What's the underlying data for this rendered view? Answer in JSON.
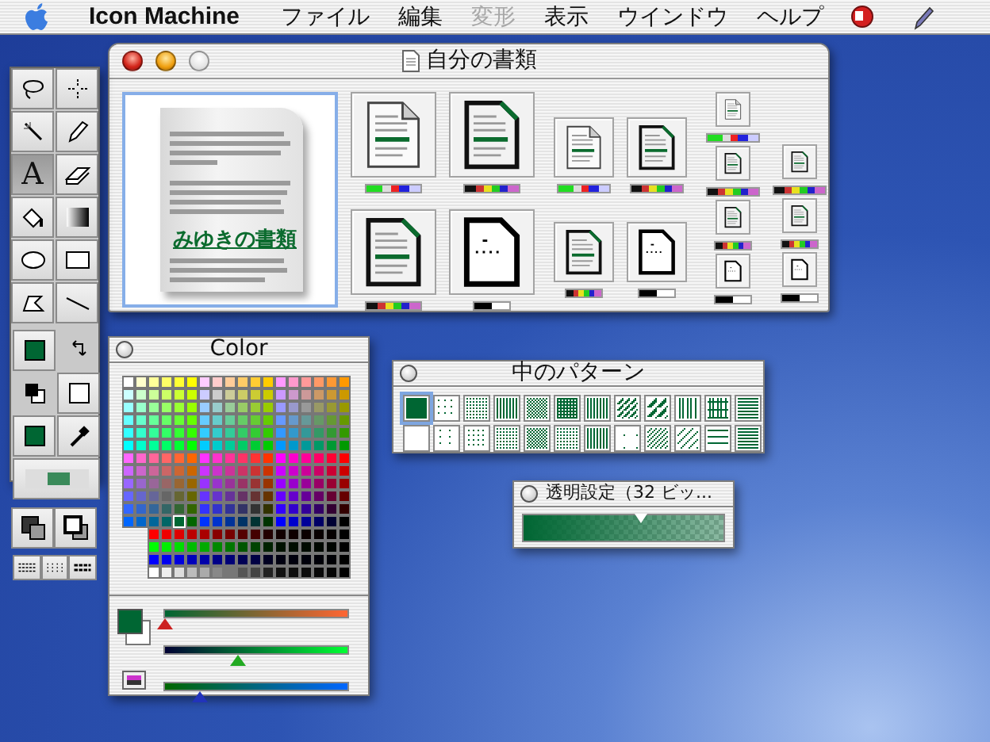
{
  "menu_bar": {
    "items": [
      {
        "label": "Icon Machine",
        "kind": "app",
        "disabled": false
      },
      {
        "label": "ファイル",
        "kind": "menu",
        "disabled": false
      },
      {
        "label": "編集",
        "kind": "menu",
        "disabled": false
      },
      {
        "label": "変形",
        "kind": "menu",
        "disabled": true
      },
      {
        "label": "表示",
        "kind": "menu",
        "disabled": false
      },
      {
        "label": "ウインドウ",
        "kind": "menu",
        "disabled": false
      },
      {
        "label": "ヘルプ",
        "kind": "menu",
        "disabled": false
      }
    ]
  },
  "tools": [
    {
      "kind": "lasso",
      "selected": false
    },
    {
      "kind": "marquee",
      "selected": false
    },
    {
      "kind": "wand",
      "selected": false
    },
    {
      "kind": "pencil",
      "selected": false
    },
    {
      "kind": "text",
      "label": "A",
      "selected": true
    },
    {
      "kind": "eraser",
      "selected": false
    },
    {
      "kind": "bucket",
      "selected": false
    },
    {
      "kind": "gradient",
      "selected": false
    },
    {
      "kind": "oval",
      "selected": false
    },
    {
      "kind": "rect",
      "selected": false
    },
    {
      "kind": "polygon",
      "selected": false
    },
    {
      "kind": "line",
      "selected": false
    }
  ],
  "document_window": {
    "title": "自分の書類",
    "window_buttons": [
      {
        "kind": "close",
        "disabled": false
      },
      {
        "kind": "minimize",
        "disabled": false
      },
      {
        "kind": "zoom",
        "disabled": true
      }
    ],
    "preview_title": "みゆきの書類"
  },
  "color_window": {
    "title": "Color",
    "current": {
      "color": "#006633"
    },
    "sliders": [
      {
        "color": "#cc2222",
        "level": 0.01
      },
      {
        "color": "#22aa22",
        "level": 0.4
      },
      {
        "color": "#2233bb",
        "level": 0.2
      }
    ]
  },
  "pattern_window": {
    "title": "中のパターン",
    "patterns": [
      {
        "selected": true
      },
      {
        "selected": false
      },
      {
        "selected": false
      },
      {
        "selected": false
      },
      {
        "selected": false
      },
      {
        "selected": false
      },
      {
        "selected": false
      },
      {
        "selected": false
      },
      {
        "selected": false
      },
      {
        "selected": false
      },
      {
        "selected": false
      },
      {
        "selected": false
      },
      {
        "selected": false
      },
      {
        "selected": false
      },
      {
        "selected": false
      },
      {
        "selected": false
      },
      {
        "selected": false
      },
      {
        "selected": false
      },
      {
        "selected": false
      },
      {
        "selected": false
      },
      {
        "selected": false
      },
      {
        "selected": false
      },
      {
        "selected": false
      },
      {
        "selected": false
      }
    ]
  },
  "transparency_window": {
    "title": "透明設定（32 ビッ...",
    "level": 0.59
  }
}
